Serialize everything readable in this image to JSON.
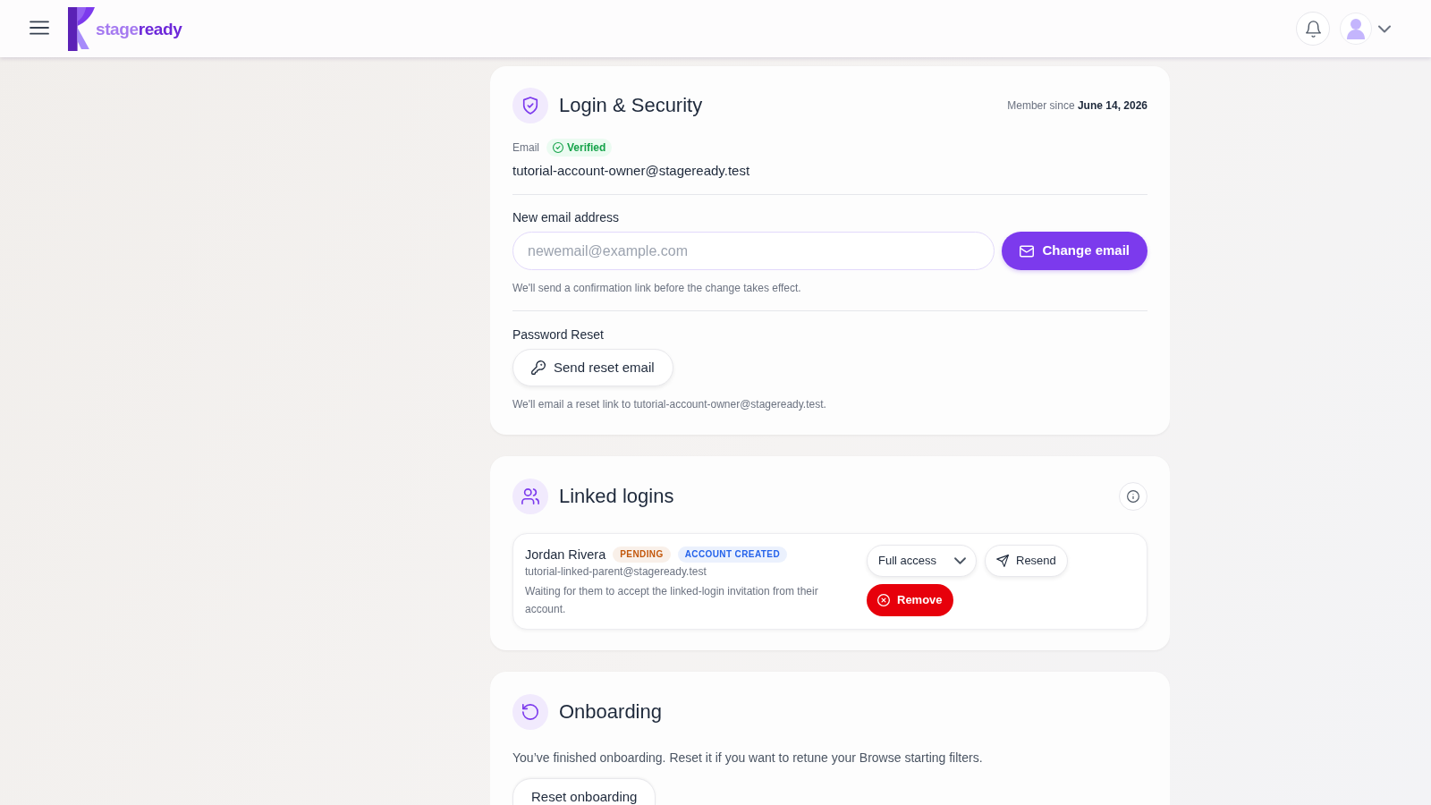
{
  "header": {
    "logo": {
      "first": "stage",
      "second": "ready"
    }
  },
  "login_security": {
    "title": "Login & Security",
    "member_since": "Member since **June 14, 2026**",
    "email_label": "Email",
    "email_status": "Verified",
    "email": "tutorial-account-owner@stageready.test",
    "new_email": {
      "label": "New email address",
      "placeholder": "newemail@example.com",
      "button": "Change email",
      "hint": "We'll send a confirmation link before the change takes effect."
    },
    "password_reset": {
      "label": "Password Reset",
      "button": "Send reset email",
      "hint": "We'll email a reset link to tutorial-account-owner@stageready.test."
    }
  },
  "linked_logins": {
    "title": "Linked logins",
    "items": [
      {
        "name": "Jordan Rivera",
        "tags": [
          {
            "text": "PENDING",
            "color": "#c2570c"
          },
          {
            "text": "ACCOUNT CREATED",
            "color": "#2563eb"
          }
        ],
        "email": "tutorial-linked-parent@stageready.test",
        "note": "Waiting for them to accept the linked-login invitation from their account.",
        "access": "Full access",
        "actions": [
          {
            "kind": "resend",
            "label": "Resend"
          },
          {
            "kind": "remove",
            "label": "Remove"
          }
        ]
      }
    ]
  },
  "onboarding": {
    "title": "Onboarding",
    "text": "You’ve finished onboarding. Reset it if you want to retune your Browse starting filters.",
    "button": "Reset onboarding"
  }
}
